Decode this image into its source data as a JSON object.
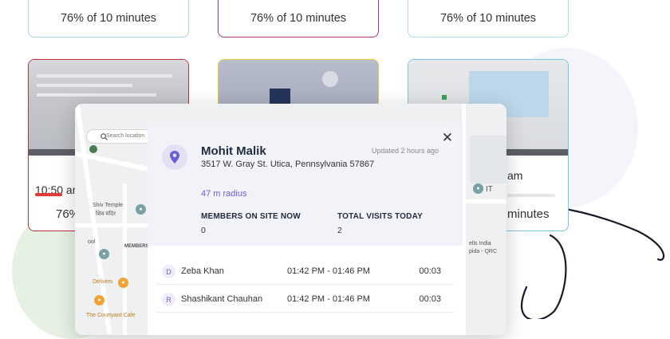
{
  "top_cards": [
    {
      "text": "76% of 10 minutes",
      "accent": "#3fb36a",
      "border": "#a9d3ee"
    },
    {
      "text": "76% of 10 minutes",
      "accent": "#f0c02a",
      "border": "#b1357a"
    },
    {
      "text": "76% of 10 minutes",
      "accent": "#3fb36a",
      "border": "#a9e0ee"
    }
  ],
  "thumb_cards": [
    {
      "time": "10:50 am",
      "pct": "76%",
      "accent": "#e03a3a",
      "border": "#b9333d"
    },
    {
      "time": "",
      "pct": "",
      "accent": "#f0c02a",
      "border": "#e8c93c"
    },
    {
      "time": "am",
      "pct": "minutes",
      "accent": "#3fb36a",
      "border": "#7cc4e4"
    }
  ],
  "map": {
    "search_placeholder": "Search location",
    "labels": {
      "temple": "Shiv Temple",
      "temple_alt": "शिव मंदिर",
      "delivers": "Delivers",
      "courtyard": "The Courtyard Cafe",
      "members_visits": "MEMBERS VISITS",
      "school": "ool",
      "india": "ells India",
      "india2": "pida - QRC",
      "it": "IT"
    }
  },
  "panel": {
    "name": "Mohit Malik",
    "updated": "Updated 2 hours ago",
    "address": "3517 W. Gray St. Utica, Pennsylvania 57867",
    "radius": "47 m radius",
    "members_label": "MEMBERS ON SITE NOW",
    "members_value": "0",
    "visits_label": "TOTAL VISITS TODAY",
    "visits_value": "2",
    "close": "✕",
    "rows": [
      {
        "initial": "D",
        "name": "Zeba Khan",
        "time": "01:42 PM - 01:46 PM",
        "duration": "00:03"
      },
      {
        "initial": "R",
        "name": "Shashikant Chauhan",
        "time": "01:42 PM - 01:46 PM",
        "duration": "00:03"
      }
    ]
  }
}
